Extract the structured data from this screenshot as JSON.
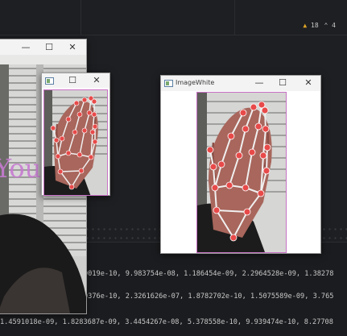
{
  "ide": {
    "warning_count": "18",
    "secondary_count": "4"
  },
  "console": {
    "lines": [
      "0019e-10, 9.983754e-08, 1.186454e-09, 2.2964528e-09, 1.38278",
      "0376e-10, 2.3261626e-07, 1.8782702e-10, 1.5075589e-09, 3.765",
      "1.4591018e-09, 1.8283687e-09, 3.4454267e-08, 5.378558e-10, 9.939474e-10, 8.27708"
    ]
  },
  "windows": {
    "camera": {
      "title": ""
    },
    "hand_small": {
      "title": ""
    },
    "image_white": {
      "title": "ImageWhite"
    }
  },
  "overlay_text": "You",
  "controls": {
    "minimize": "—",
    "maximize": "☐",
    "close": "✕"
  },
  "colors": {
    "ide_background": "#1e1f22",
    "warning": "#e0a526",
    "landmark": "#e84a4a",
    "connection": "#f0f0f0",
    "frame_border": "#c770c4"
  },
  "icons": [
    "window-app-icon",
    "minimize-icon",
    "maximize-icon",
    "close-icon",
    "warning-icon"
  ]
}
